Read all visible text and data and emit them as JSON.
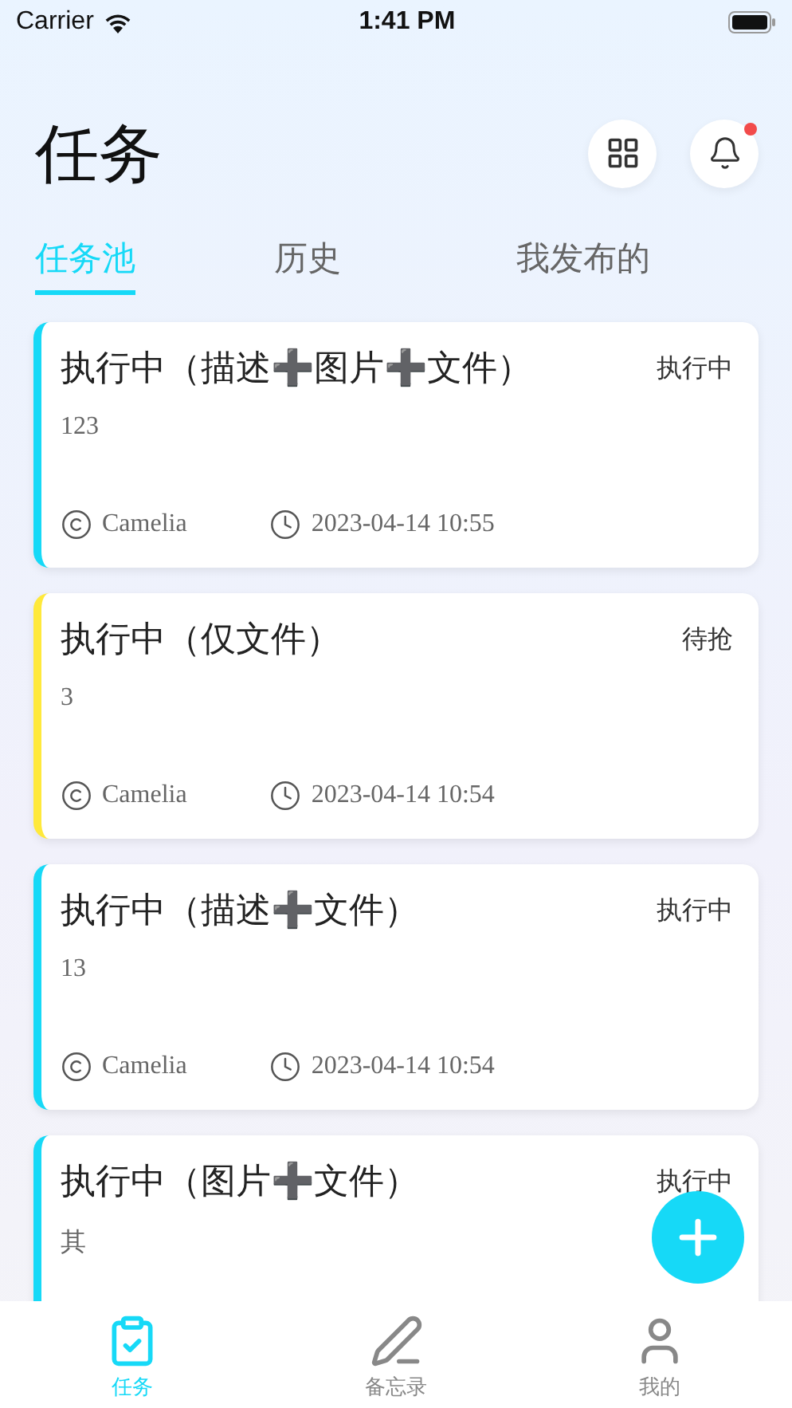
{
  "status_bar": {
    "carrier": "Carrier",
    "time": "1:41 PM"
  },
  "header": {
    "title": "任务",
    "notification_dot": true
  },
  "tabs": [
    {
      "label": "任务池",
      "selected": true
    },
    {
      "label": "历史",
      "selected": false
    },
    {
      "label": "我发布的",
      "selected": false
    }
  ],
  "tasks": [
    {
      "title": "执行中（描述➕图片➕文件）",
      "status": "执行中",
      "description": "123",
      "author": "Camelia",
      "time": "2023-04-14 10:55",
      "color": "#16d9f7"
    },
    {
      "title": "执行中（仅文件）",
      "status": "待抢",
      "description": "3",
      "author": "Camelia",
      "time": "2023-04-14 10:54",
      "color": "#ffe93b"
    },
    {
      "title": "执行中（描述➕文件）",
      "status": "执行中",
      "description": "13",
      "author": "Camelia",
      "time": "2023-04-14 10:54",
      "color": "#16d9f7"
    },
    {
      "title": "执行中（图片➕文件）",
      "status": "执行中",
      "description": "其",
      "color": "#16d9f7"
    }
  ],
  "bottom_nav": [
    {
      "label": "任务",
      "selected": true
    },
    {
      "label": "备忘录",
      "selected": false
    },
    {
      "label": "我的",
      "selected": false
    }
  ]
}
